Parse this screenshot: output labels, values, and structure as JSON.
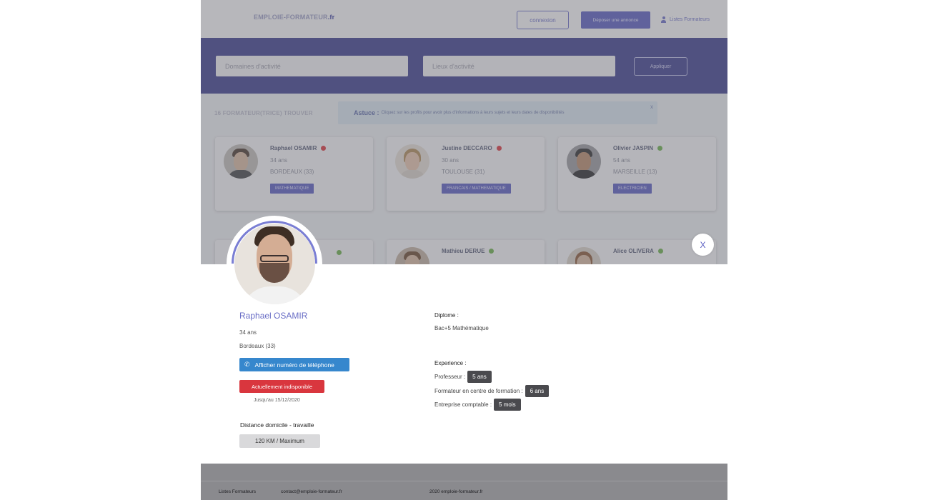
{
  "header": {
    "logo_main": "EMPLOIE-FORMATEUR",
    "logo_tld": ".fr",
    "connexion_label": "connexion",
    "deposer_label": "Déposer une annonce",
    "listes_label": "Listes Formateurs"
  },
  "filters": {
    "domaines_placeholder": "Domaines d'activité",
    "lieux_placeholder": "Lieux d'activité",
    "appliquer_label": "Appliquer"
  },
  "results": {
    "count_label": "16 FORMATEUR(TRICE) TROUVER",
    "tip_title": "Astuce :",
    "tip_text": "Cliquez sur les profils pour avoir plus d'informations à leurs sujets et leurs dates de disponibilités",
    "tip_close": "x"
  },
  "cards": [
    {
      "name": "Raphael OSAMIR",
      "age": "34 ans",
      "city": "BORDEAUX (33)",
      "tag": "MATHEMATIQUE",
      "status_color": "#d9363e"
    },
    {
      "name": "Justine DECCARO",
      "age": "30 ans",
      "city": "TOULOUSE (31)",
      "tag": "FRANCAIS / MATHEMATIQUE",
      "status_color": "#d9363e"
    },
    {
      "name": "Olivier JASPIN",
      "age": "54 ans",
      "city": "MARSEILLE (13)",
      "tag": "ELECTRICIEN",
      "status_color": "#6ab04c"
    },
    {
      "name": "Mathieu DERUE",
      "status_color": "#6ab04c"
    },
    {
      "name": "Alice OLIVERA",
      "status_color": "#6ab04c"
    }
  ],
  "profile": {
    "close_label": "X",
    "name": "Raphael OSAMIR",
    "age": "34 ans",
    "city": "Bordeaux (33)",
    "phone_button": "Afficher numéro de téléphone",
    "status": "Actuellement indisponible",
    "until": "Jusqu'au 15/12/2020",
    "distance_label": "Distance domicile - travaille",
    "distance_value": "120 KM / Maximum",
    "diploma_label": "Diplome :",
    "diploma_value": "Bac+5 Mathématique",
    "experience_label": "Experience :",
    "experiences": [
      {
        "label": "Professeur :",
        "duration": "5 ans"
      },
      {
        "label": "Formateur en centre de formation :",
        "duration": "6 ans"
      },
      {
        "label": "Entreprise comptable :",
        "duration": "5 mois"
      }
    ]
  },
  "footer": {
    "listes": "Listes Formateurs",
    "contact": "contact@emploie-formateur.fr",
    "copyright": "2020 emploie-formateur.fr"
  },
  "colors": {
    "accent": "#5a5ec2",
    "filter_bar": "#3d3f8f",
    "unavailable": "#d9363e",
    "available": "#6ab04c",
    "phone_button": "#3687cd"
  }
}
